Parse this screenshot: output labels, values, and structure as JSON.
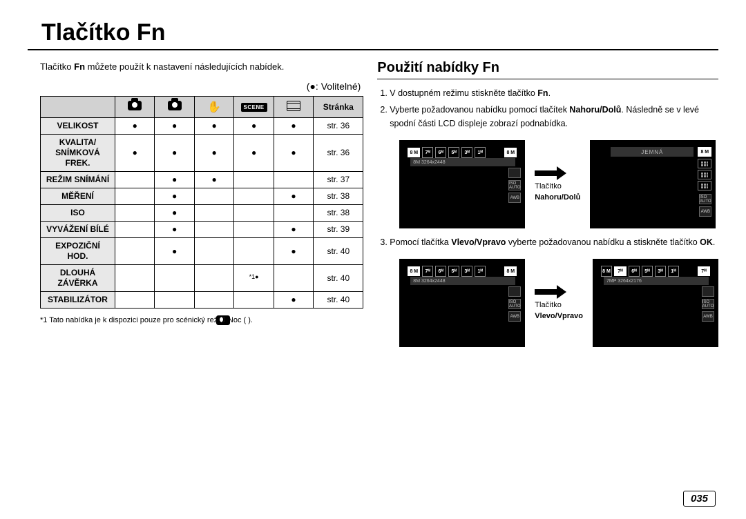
{
  "page_title": "Tlačítko Fn",
  "intro_pre": "Tlačítko ",
  "intro_bold": "Fn",
  "intro_post": " můžete použít k nastavení následujících nabídek.",
  "optional_note": "(●: Volitelné)",
  "table": {
    "col_headers": [
      "",
      "",
      "",
      "",
      "",
      "Stránka"
    ],
    "mode_icons": [
      "camera",
      "camera-face",
      "hand",
      "scene",
      "movie"
    ],
    "rows": [
      {
        "label": "VELIKOST",
        "cells": [
          "●",
          "●",
          "●",
          "●",
          "●"
        ],
        "page": "str. 36"
      },
      {
        "label": "KVALITA/\nSNÍMKOVÁ\nFREK.",
        "cells": [
          "●",
          "●",
          "●",
          "●",
          "●"
        ],
        "page": "str. 36"
      },
      {
        "label": "REŽIM SNÍMÁNÍ",
        "cells": [
          "",
          "●",
          "●",
          "",
          ""
        ],
        "page": "str. 37"
      },
      {
        "label": "MĚŘENÍ",
        "cells": [
          "",
          "●",
          "",
          "",
          "●"
        ],
        "page": "str. 38"
      },
      {
        "label": "ISO",
        "cells": [
          "",
          "●",
          "",
          "",
          ""
        ],
        "page": "str. 38"
      },
      {
        "label": "VYVÁŽENÍ BÍLÉ",
        "cells": [
          "",
          "●",
          "",
          "",
          "●"
        ],
        "page": "str. 39"
      },
      {
        "label": "EXPOZIČNÍ\nHOD.",
        "cells": [
          "",
          "●",
          "",
          "",
          "●"
        ],
        "page": "str. 40"
      },
      {
        "label": "DLOUHÁ\nZÁVĚRKA",
        "cells": [
          "",
          "",
          "",
          "*1●",
          ""
        ],
        "page": "str. 40"
      },
      {
        "label": "STABILIZÁTOR",
        "cells": [
          "",
          "",
          "",
          "",
          "●"
        ],
        "page": "str. 40"
      }
    ]
  },
  "footnote": "*1 Tato nabídka je k dispozici pouze pro scénický režim Noc (        ).",
  "right": {
    "heading": "Použití nabídky Fn",
    "step1_pre": "V dostupném režimu stiskněte tlačítko ",
    "step1_bold": "Fn",
    "step1_post": ".",
    "step2_pre": "Vyberte požadovanou nabídku pomocí tlačítek ",
    "step2_bold": "Nahoru/Dolů",
    "step2_post": ". Následně se v levé spodní části LCD displeje zobrazí podnabídka.",
    "step3_pre": "Pomocí tlačítka ",
    "step3_bold1": "Vlevo/Vpravo",
    "step3_mid": " vyberte požadovanou nabídku a stiskněte tlačítko ",
    "step3_bold2": "OK",
    "step3_post": ".",
    "arrow1_line1": "Tlačítko",
    "arrow1_line2": "Nahoru/Dolů",
    "arrow2_line1": "Tlačítko",
    "arrow2_line2": "Vlevo/Vpravo"
  },
  "lcd": {
    "sel": "8 M",
    "opts": [
      "7ᴹ",
      "6ᴹ",
      "5ᴹ",
      "3ᴹ",
      "1ᴹ"
    ],
    "sub_label": "8M 3264x2448",
    "q_label": "JEMNÁ",
    "side": [
      "",
      "ISO\nAUTO",
      "AWB"
    ],
    "lcd3_sublabel": "8M 3264x2448",
    "lcd4_sublabel": "7MP 3264x2176"
  },
  "page_number": "035"
}
